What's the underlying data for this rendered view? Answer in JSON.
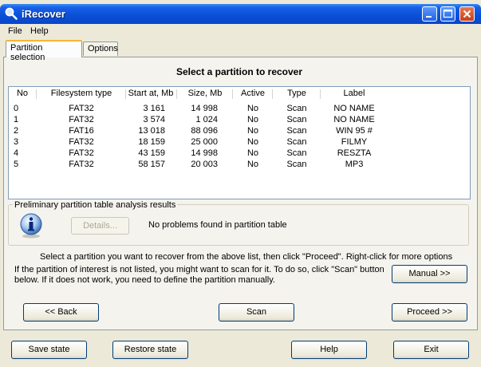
{
  "window": {
    "title": "iRecover"
  },
  "menu": [
    "File",
    "Help"
  ],
  "tabs": [
    {
      "label": "Partition selection",
      "active": true
    },
    {
      "label": "Options",
      "active": false
    }
  ],
  "header": {
    "title": "Select a partition to recover"
  },
  "table": {
    "columns": [
      "No",
      "Filesystem type",
      "Start at, Mb",
      "Size, Mb",
      "Active",
      "Type",
      "Label"
    ],
    "rows": [
      [
        "0",
        "FAT32",
        "3 161",
        "14 998",
        "No",
        "Scan",
        "NO NAME"
      ],
      [
        "1",
        "FAT32",
        "3 574",
        "1 024",
        "No",
        "Scan",
        "NO NAME"
      ],
      [
        "2",
        "FAT16",
        "13 018",
        "88 096",
        "No",
        "Scan",
        "WIN 95 #"
      ],
      [
        "3",
        "FAT32",
        "18 159",
        "25 000",
        "No",
        "Scan",
        "FILMY"
      ],
      [
        "4",
        "FAT32",
        "43 159",
        "14 998",
        "No",
        "Scan",
        "RESZTA"
      ],
      [
        "5",
        "FAT32",
        "58 157",
        "20 003",
        "No",
        "Scan",
        "MP3"
      ]
    ]
  },
  "analysis": {
    "title": "Preliminary partition table analysis results",
    "details_label": "Details...",
    "message": "No problems found in partition table"
  },
  "instructions": {
    "line1": "Select a partition you want to recover from the above list, then click \"Proceed\". Right-click for more options",
    "line2": "If the partition of interest is not listed, you might want to scan for it. To do so, click \"Scan\" button",
    "line3": "below. If it does not work, you need to define the partition manually."
  },
  "buttons": {
    "manual": "Manual >>",
    "back": "<< Back",
    "scan": "Scan",
    "proceed": "Proceed >>",
    "save_state": "Save state",
    "restore_state": "Restore state",
    "help": "Help",
    "exit": "Exit"
  },
  "icons": {
    "app": "magnifier-icon",
    "info": "info-icon",
    "minimize": "minimize-icon",
    "maximize": "maximize-icon",
    "close": "close-icon"
  }
}
